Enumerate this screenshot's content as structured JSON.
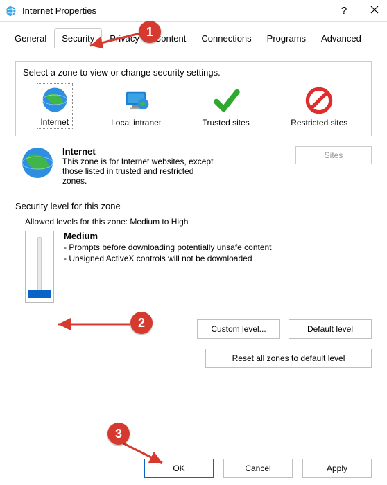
{
  "window": {
    "title": "Internet Properties"
  },
  "tabs": {
    "general": "General",
    "security": "Security",
    "privacy": "Privacy",
    "content": "Content",
    "connections": "Connections",
    "programs": "Programs",
    "advanced": "Advanced"
  },
  "zones": {
    "prompt": "Select a zone to view or change security settings.",
    "internet": "Internet",
    "local_intranet": "Local intranet",
    "trusted_sites": "Trusted sites",
    "restricted_sites": "Restricted sites"
  },
  "zone_detail": {
    "title": "Internet",
    "desc": "This zone is for Internet websites, except those listed in trusted and restricted zones.",
    "sites_btn": "Sites"
  },
  "security": {
    "heading": "Security level for this zone",
    "allowed": "Allowed levels for this zone: Medium to High",
    "level": "Medium",
    "bullet1": "- Prompts before downloading potentially unsafe content",
    "bullet2": "- Unsigned ActiveX controls will not be downloaded",
    "custom_btn": "Custom level...",
    "default_btn": "Default level",
    "reset_btn": "Reset all zones to default level"
  },
  "buttons": {
    "ok": "OK",
    "cancel": "Cancel",
    "apply": "Apply"
  },
  "annotations": {
    "a1": "1",
    "a2": "2",
    "a3": "3"
  }
}
